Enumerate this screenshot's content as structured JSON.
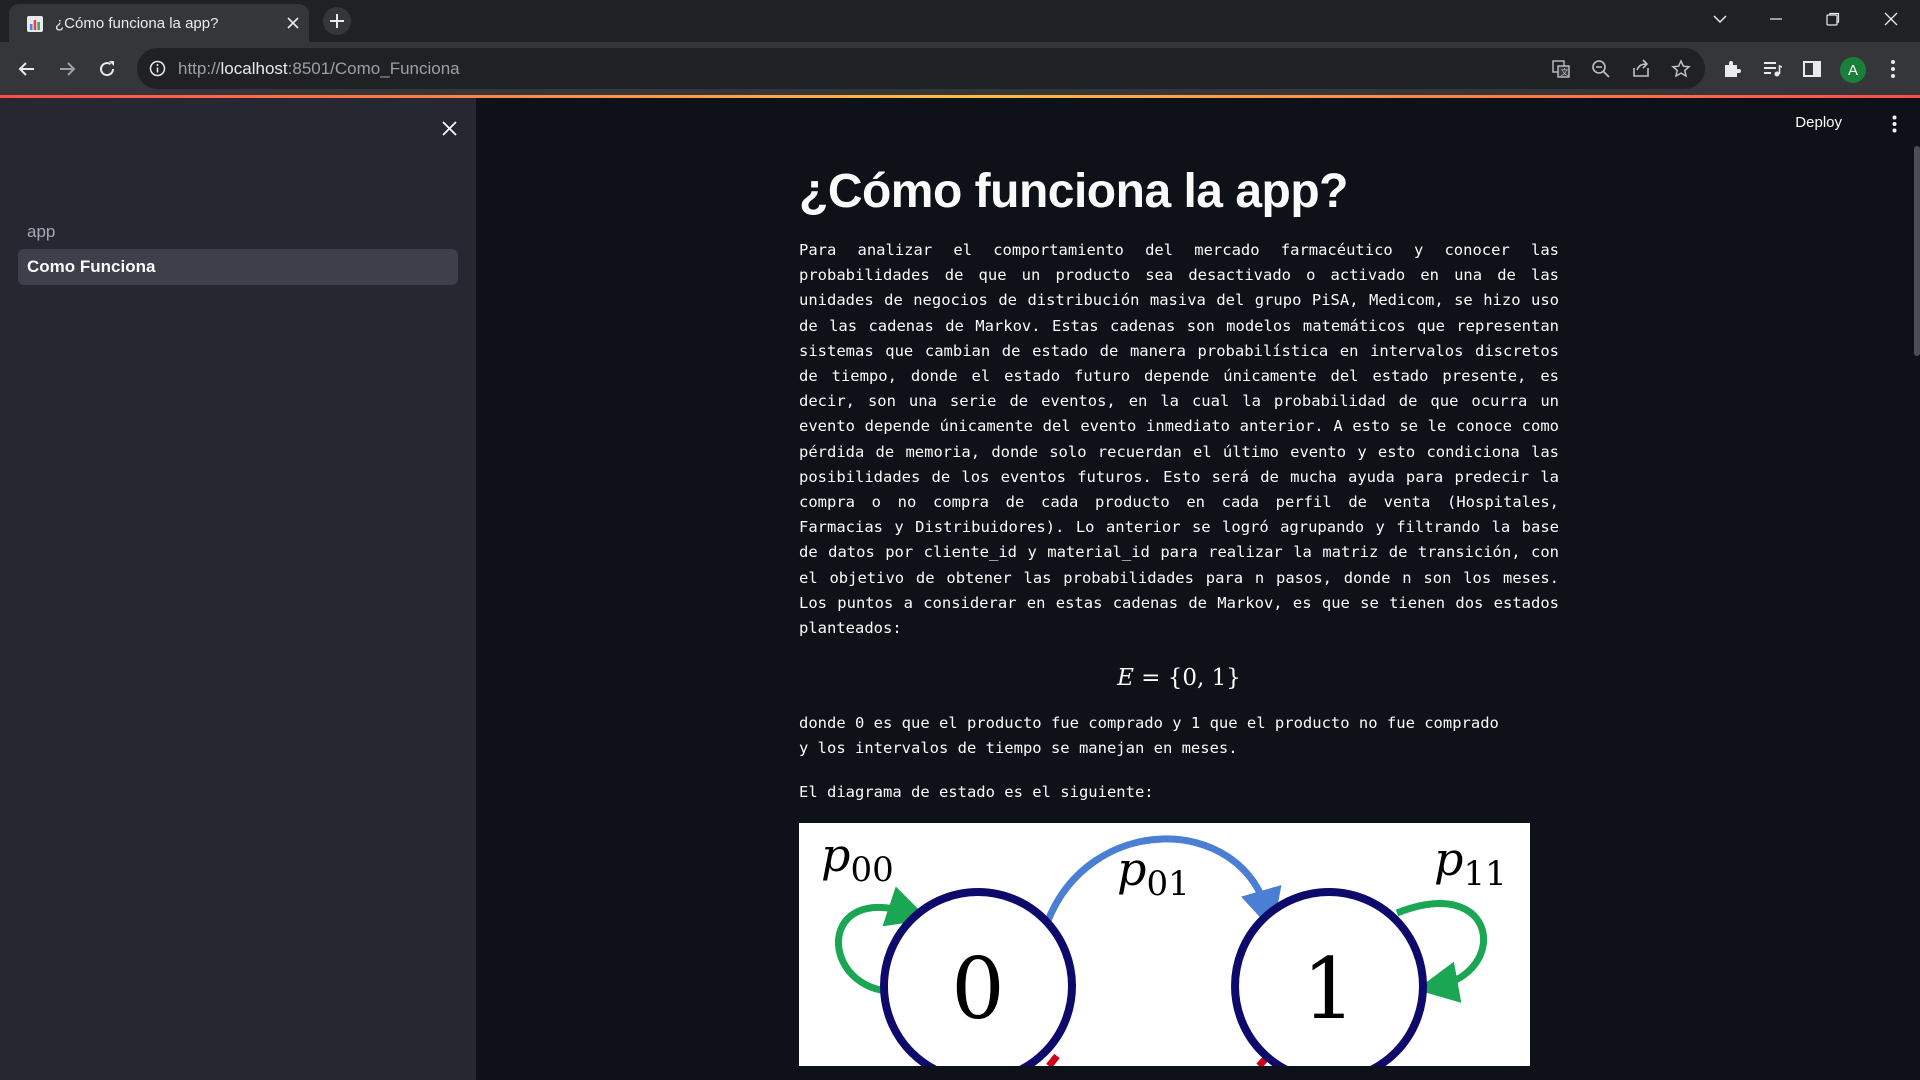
{
  "browser": {
    "tab_title": "¿Cómo funciona la app?",
    "url_scheme": "http://",
    "url_host": "localhost",
    "url_path": ":8501/Como_Funciona",
    "profile_initial": "A"
  },
  "sidebar": {
    "items": [
      {
        "label": "app",
        "active": false
      },
      {
        "label": "Como Funciona",
        "active": true
      }
    ]
  },
  "header": {
    "deploy_label": "Deploy"
  },
  "main": {
    "title": "¿Cómo funciona la app?",
    "paragraph1": "Para analizar el comportamiento del mercado farmacéutico y conocer las probabilidades de que un producto sea desactivado o activado en una de las unidades de negocios de distribución masiva del grupo PiSA, Medicom, se hizo uso de las cadenas de Markov. Estas cadenas son modelos matemáticos que representan sistemas que cambian de estado de manera probabilística en intervalos discretos de tiempo, donde el estado futuro depende únicamente del estado presente, es decir, son una serie de eventos, en la cual la probabilidad de que ocurra un evento depende únicamente del evento inmediato anterior. A esto se le conoce como pérdida de memoria, donde solo recuerdan el último evento y esto condiciona las posibilidades de los eventos futuros. Esto será de mucha ayuda para predecir la compra o no compra de cada producto en cada perfil de venta (Hospitales, Farmacias y Distribuidores). Lo anterior se logró agrupando y filtrando la base de datos por cliente_id y material_id para realizar la matriz de transición, con el objetivo de obtener las probabilidades para n pasos, donde n son los meses. Los puntos a considerar en estas cadenas de Markov, es que se tienen dos estados planteados:",
    "formula_lhs": "E",
    "formula_rhs": " = {0, 1}",
    "paragraph2_line1": "donde 0 es que el producto fue comprado y 1 que el producto no fue comprado",
    "paragraph2_line2": "y los intervalos de tiempo se manejan en meses.",
    "paragraph3": "El diagrama de estado es el siguiente:",
    "diagram": {
      "state0": "0",
      "state1": "1",
      "p00": "p",
      "p00_sub": "00",
      "p01": "p",
      "p01_sub": "01",
      "p11": "p",
      "p11_sub": "11",
      "colors": {
        "circle": "#0d0a6b",
        "self_loop": "#1aa653",
        "transition": "#4a7fd4",
        "bottom_arrow": "#d0021b"
      }
    }
  }
}
